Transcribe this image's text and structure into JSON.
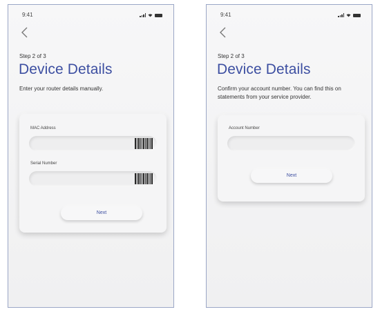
{
  "screens": [
    {
      "status_time": "9:41",
      "step": "Step 2 of 3",
      "title": "Device Details",
      "description": "Enter your router details manually.",
      "fields": [
        {
          "label": "MAC Address",
          "value": "",
          "icon": "barcode-icon"
        },
        {
          "label": "Serial Number",
          "value": "",
          "icon": "barcode-icon"
        }
      ],
      "button_label": "Next"
    },
    {
      "status_time": "9:41",
      "step": "Step 2 of 3",
      "title": "Device Details",
      "description": "Confirm your account number. You can find this on statements from your service provider.",
      "fields": [
        {
          "label": "Account Number",
          "value": ""
        }
      ],
      "button_label": "Next"
    }
  ],
  "colors": {
    "accent": "#3d4fa1",
    "frame": "#9aa6c6",
    "background": "#f3f3f4"
  }
}
